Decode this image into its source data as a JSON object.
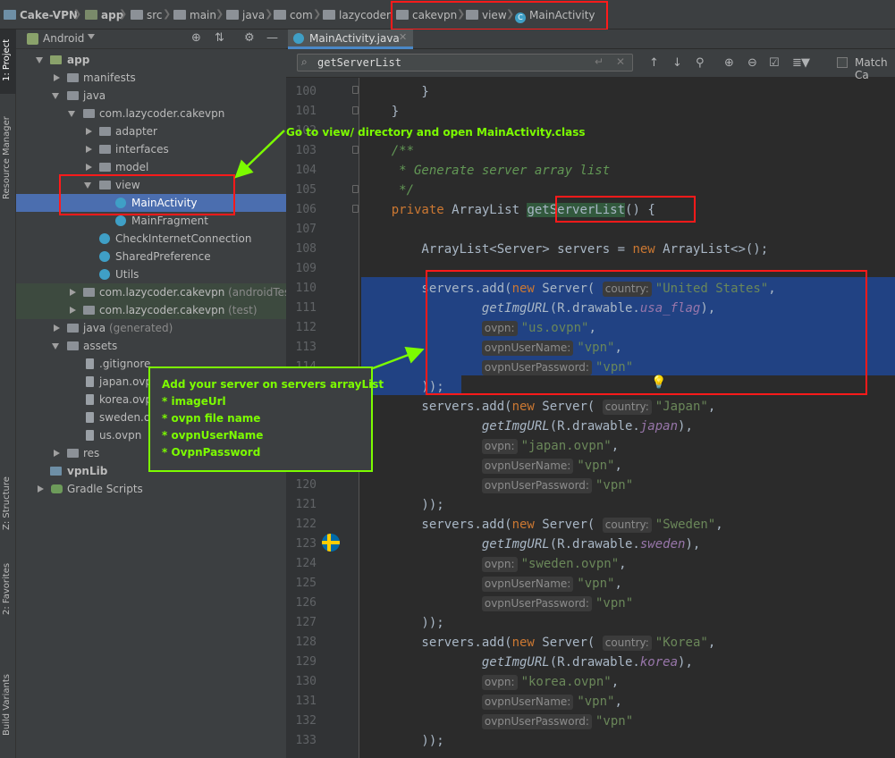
{
  "breadcrumb": {
    "items": [
      "Cake-VPN",
      "app",
      "src",
      "main",
      "java",
      "com",
      "lazycoder",
      "cakevpn",
      "view",
      "MainActivity"
    ]
  },
  "toolstrip": {
    "project": "1: Project",
    "resource_manager": "Resource Manager",
    "structure": "Z: Structure",
    "favorites": "2: Favorites",
    "build_variants": "Build Variants"
  },
  "project_panel": {
    "view_selector": "Android",
    "tree": [
      {
        "label": "app",
        "suffix": ""
      },
      {
        "label": "manifests",
        "suffix": ""
      },
      {
        "label": "java",
        "suffix": ""
      },
      {
        "label": "com.lazycoder.cakevpn",
        "suffix": ""
      },
      {
        "label": "adapter",
        "suffix": ""
      },
      {
        "label": "interfaces",
        "suffix": ""
      },
      {
        "label": "model",
        "suffix": ""
      },
      {
        "label": "view",
        "suffix": ""
      },
      {
        "label": "MainActivity",
        "suffix": ""
      },
      {
        "label": "MainFragment",
        "suffix": ""
      },
      {
        "label": "CheckInternetConnection",
        "suffix": ""
      },
      {
        "label": "SharedPreference",
        "suffix": ""
      },
      {
        "label": "Utils",
        "suffix": ""
      },
      {
        "label": "com.lazycoder.cakevpn",
        "suffix": "(androidTest)"
      },
      {
        "label": "com.lazycoder.cakevpn",
        "suffix": "(test)"
      },
      {
        "label": "java",
        "suffix": "(generated)"
      },
      {
        "label": "assets",
        "suffix": ""
      },
      {
        "label": ".gitignore",
        "suffix": ""
      },
      {
        "label": "japan.ovpn",
        "suffix": ""
      },
      {
        "label": "korea.ovpn",
        "suffix": ""
      },
      {
        "label": "sweden.ovpn",
        "suffix": ""
      },
      {
        "label": "us.ovpn",
        "suffix": ""
      },
      {
        "label": "res",
        "suffix": ""
      },
      {
        "label": "vpnLib",
        "suffix": ""
      },
      {
        "label": "Gradle Scripts",
        "suffix": ""
      }
    ]
  },
  "editor": {
    "tab_label": "MainActivity.java",
    "search_value": "getServerList",
    "match_case_label": "Match Ca",
    "line_numbers": [
      "100",
      "101",
      "102",
      "103",
      "104",
      "105",
      "106",
      "107",
      "108",
      "109",
      "110",
      "111",
      "112",
      "113",
      "114",
      "115",
      "116",
      "117",
      "118",
      "119",
      "120",
      "121",
      "122",
      "123",
      "124",
      "125",
      "126",
      "127",
      "128",
      "129",
      "130",
      "131",
      "132",
      "133"
    ],
    "hints": {
      "country": "country:",
      "ovpn": "ovpn:",
      "user": "ovpnUserName:",
      "pass": "ovpnUserPassword:"
    }
  },
  "annotations": {
    "arrow_note": "Go to view/ directory and open MainActivity.class",
    "box_title": "Add your server on servers arrayList",
    "box_items": [
      "* imageUrl",
      "* ovpn file name",
      "* ovpnUserName",
      "* OvpnPassword"
    ]
  },
  "colors": {
    "annotation": "#7cfc00",
    "highlight_box": "#ff1a1a",
    "selection": "#214283"
  }
}
